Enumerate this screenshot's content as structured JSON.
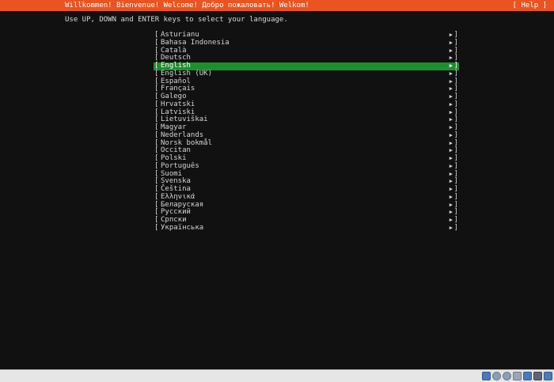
{
  "header": {
    "title": "Willkommen! Bienvenue! Welcome! Добро пожаловать! Welkom!",
    "help_label": "[ Help ]"
  },
  "instructions": "Use UP, DOWN and ENTER keys to select your language.",
  "list": {
    "bracket_left": "[",
    "bracket_right": "]",
    "arrow": "▶",
    "selected_index": 4,
    "items": [
      {
        "label": "Asturianu"
      },
      {
        "label": "Bahasa Indonesia"
      },
      {
        "label": "Català"
      },
      {
        "label": "Deutsch"
      },
      {
        "label": "English"
      },
      {
        "label": "English (UK)"
      },
      {
        "label": "Español"
      },
      {
        "label": "Français"
      },
      {
        "label": "Galego"
      },
      {
        "label": "Hrvatski"
      },
      {
        "label": "Latviski"
      },
      {
        "label": "Lietuviškai"
      },
      {
        "label": "Magyar"
      },
      {
        "label": "Nederlands"
      },
      {
        "label": "Norsk bokmål"
      },
      {
        "label": "Occitan"
      },
      {
        "label": "Polski"
      },
      {
        "label": "Português"
      },
      {
        "label": "Suomi"
      },
      {
        "label": "Svenska"
      },
      {
        "label": "Čeština"
      },
      {
        "label": "Ελληνικά"
      },
      {
        "label": "Беларуская"
      },
      {
        "label": "Русский"
      },
      {
        "label": "Српски"
      },
      {
        "label": "Українська"
      }
    ]
  },
  "colors": {
    "header_bg": "#e95420",
    "selected_bg": "#1e8f2e",
    "background": "#111111"
  },
  "tray_icons": [
    "network-icon",
    "usb-icon",
    "cd-icon",
    "shared-folder-icon",
    "display-icon",
    "recording-icon",
    "keyboard-capture-icon"
  ]
}
